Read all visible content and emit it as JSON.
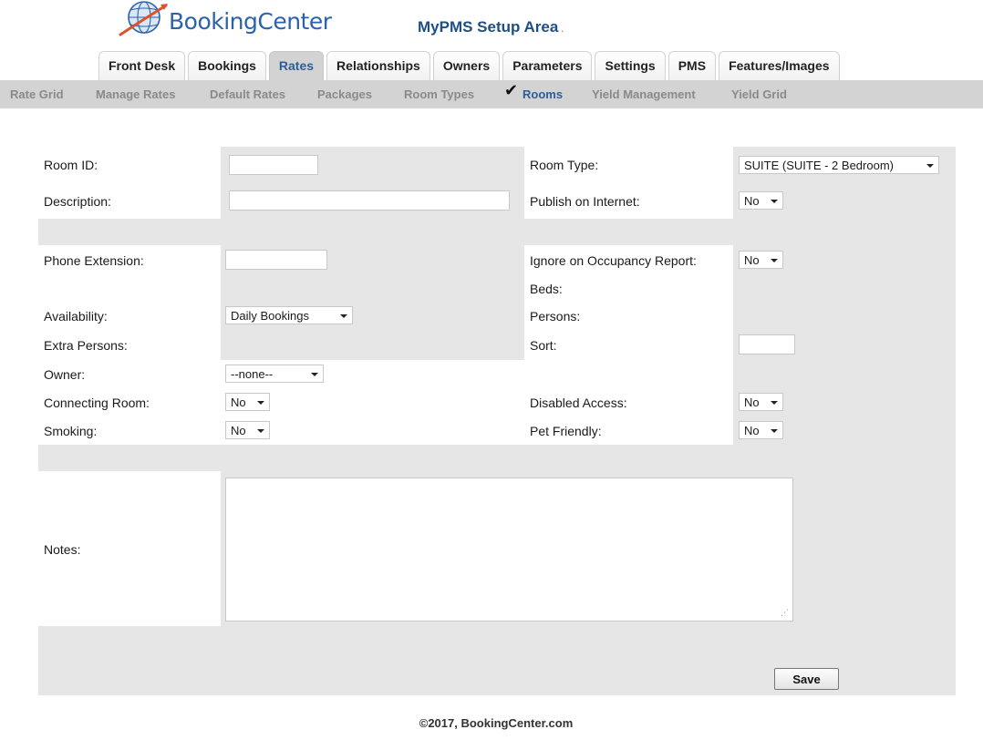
{
  "brand": {
    "logo_text": "BookingCenter",
    "app_title": "MyPMS Setup Area",
    "app_title_suffix": "."
  },
  "main_tabs": [
    {
      "label": "Front Desk"
    },
    {
      "label": "Bookings"
    },
    {
      "label": "Rates",
      "active": true
    },
    {
      "label": "Relationships"
    },
    {
      "label": "Owners"
    },
    {
      "label": "Parameters"
    },
    {
      "label": "Settings"
    },
    {
      "label": "PMS"
    },
    {
      "label": "Features/Images"
    }
  ],
  "sub_nav": [
    {
      "label": "Rate Grid"
    },
    {
      "label": "Manage Rates"
    },
    {
      "label": "Default Rates"
    },
    {
      "label": "Packages"
    },
    {
      "label": "Room Types"
    },
    {
      "label": "Rooms",
      "active": true
    },
    {
      "label": "Yield Management"
    },
    {
      "label": "Yield Grid"
    }
  ],
  "form": {
    "room_id": {
      "label": "Room ID:",
      "value": ""
    },
    "room_type": {
      "label": "Room Type:",
      "value": "SUITE (SUITE - 2 Bedroom)"
    },
    "description": {
      "label": "Description:",
      "value": ""
    },
    "publish_on_internet": {
      "label": "Publish on Internet:",
      "value": "No"
    },
    "phone_extension": {
      "label": "Phone Extension:",
      "value": ""
    },
    "ignore_occupancy": {
      "label": "Ignore on Occupancy Report:",
      "value": "No"
    },
    "beds": {
      "label": "Beds:"
    },
    "availability": {
      "label": "Availability:",
      "value": "Daily Bookings"
    },
    "persons": {
      "label": "Persons:"
    },
    "extra_persons": {
      "label": "Extra Persons:"
    },
    "sort": {
      "label": "Sort:",
      "value": ""
    },
    "owner": {
      "label": "Owner:",
      "value": "--none--"
    },
    "connecting_room": {
      "label": "Connecting Room:",
      "value": "No"
    },
    "disabled_access": {
      "label": "Disabled Access:",
      "value": "No"
    },
    "smoking": {
      "label": "Smoking:",
      "value": "No"
    },
    "pet_friendly": {
      "label": "Pet Friendly:",
      "value": "No"
    },
    "notes": {
      "label": "Notes:",
      "value": ""
    },
    "save_label": "Save"
  },
  "footer": {
    "copyright": "©2017, BookingCenter.com"
  },
  "colors": {
    "accent": "#2c5f95",
    "nav_bg": "#d3d3d3",
    "panel_bg": "#e6e6e6",
    "logo_blue": "#2a62ad",
    "logo_swoosh": "#d9542b"
  }
}
